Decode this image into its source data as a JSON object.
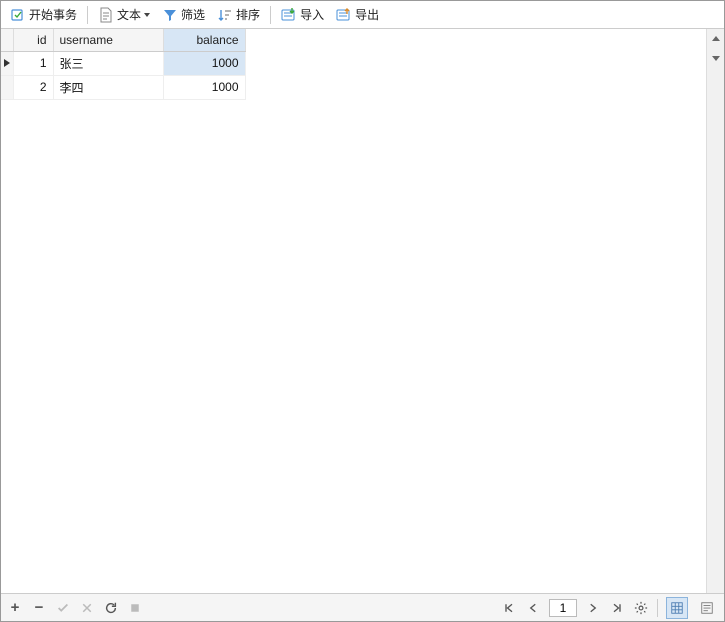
{
  "toolbar": {
    "begin_transaction": "开始事务",
    "text": "文本",
    "filter": "筛选",
    "sort": "排序",
    "import": "导入",
    "export": "导出"
  },
  "table": {
    "columns": [
      "id",
      "username",
      "balance"
    ],
    "selected_column_index": 2,
    "selected_row_index": 0,
    "selected_cell": {
      "row": 0,
      "col": 2
    },
    "rows": [
      {
        "id": 1,
        "username": "张三",
        "balance": 1000
      },
      {
        "id": 2,
        "username": "李四",
        "balance": 1000
      }
    ]
  },
  "pager": {
    "current_page": "1"
  }
}
